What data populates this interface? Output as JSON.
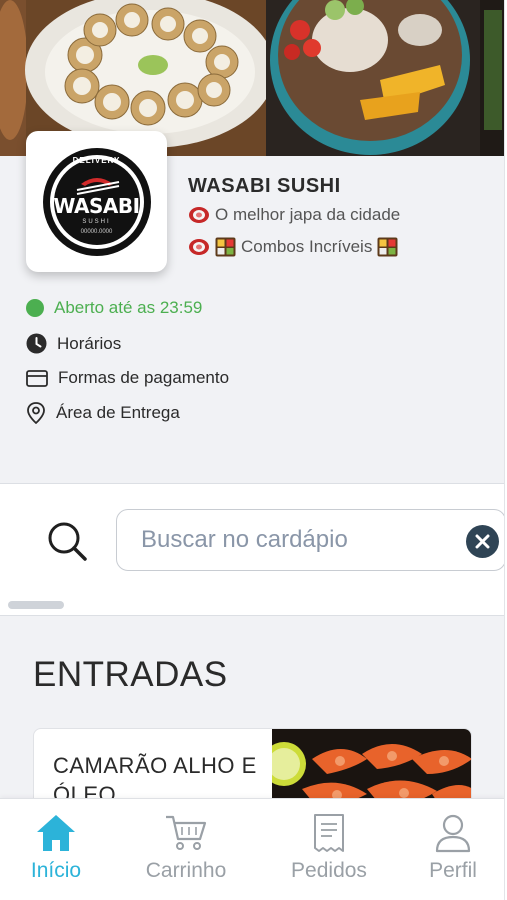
{
  "store": {
    "name": "WASABI SUSHI",
    "tagline": "O melhor japa da cidade",
    "promo": "Combos Incríveis",
    "logo_text": "WASABI",
    "logo_top_text": "DELIVERY",
    "logo_bottom_text": "SUSHI",
    "logo_phone": "00000.0000"
  },
  "status": {
    "open_text": "Aberto até as 23:59",
    "color": "#4caf50"
  },
  "info": {
    "hours_label": "Horários",
    "payment_label": "Formas de pagamento",
    "area_label": "Área de Entrega"
  },
  "search": {
    "placeholder": "Buscar no cardápio",
    "value": ""
  },
  "menu": {
    "section_title": "ENTRADAS",
    "items": [
      {
        "name": "CAMARÃO ALHO E ÓLEO"
      }
    ]
  },
  "nav": {
    "home": "Início",
    "cart": "Carrinho",
    "orders": "Pedidos",
    "profile": "Perfil",
    "active": "home"
  },
  "colors": {
    "accent": "#2cb3d9",
    "inactive": "#9aa0a6",
    "open": "#4caf50"
  },
  "icons": {
    "search": "search-icon",
    "clear": "clear-icon",
    "clock": "clock-icon",
    "card": "credit-card-icon",
    "pin": "location-pin-icon",
    "home": "home-icon",
    "cart": "cart-icon",
    "orders": "receipt-icon",
    "profile": "user-icon"
  }
}
